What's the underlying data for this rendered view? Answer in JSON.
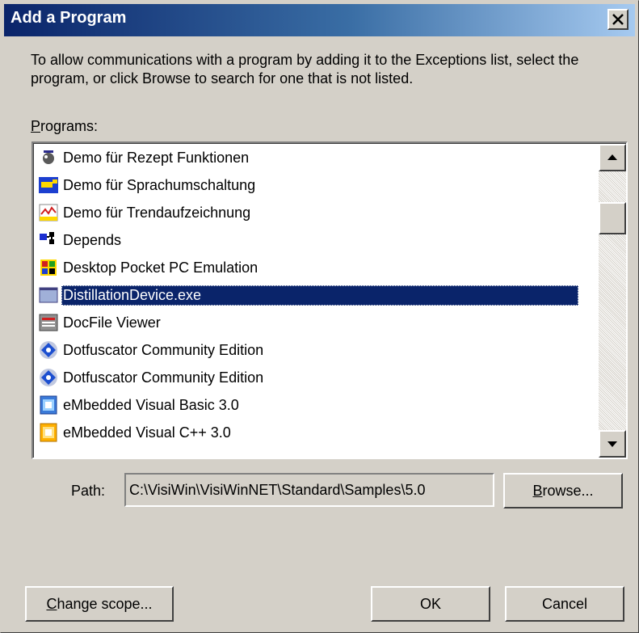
{
  "window": {
    "title": "Add a Program"
  },
  "description": "To allow communications with a program by adding it to the Exceptions list, select the program, or click Browse to search for one that is not listed.",
  "programs_label": {
    "mnemonic": "P",
    "rest": "rograms:"
  },
  "programs": [
    {
      "label": "Demo für Rezept Funktionen",
      "icon": "recipe-icon",
      "selected": false
    },
    {
      "label": "Demo für Sprachumschaltung",
      "icon": "language-flag-icon",
      "selected": false
    },
    {
      "label": "Demo für Trendaufzeichnung",
      "icon": "trend-chart-icon",
      "selected": false
    },
    {
      "label": "Depends",
      "icon": "depends-icon",
      "selected": false
    },
    {
      "label": "Desktop Pocket PC Emulation",
      "icon": "emulator-icon",
      "selected": false
    },
    {
      "label": "DistillationDevice.exe",
      "icon": "app-window-icon",
      "selected": true
    },
    {
      "label": "DocFile Viewer",
      "icon": "docfile-viewer-icon",
      "selected": false
    },
    {
      "label": "Dotfuscator Community Edition",
      "icon": "dotfuscator-icon",
      "selected": false
    },
    {
      "label": "Dotfuscator Community Edition",
      "icon": "dotfuscator-icon",
      "selected": false
    },
    {
      "label": "eMbedded Visual Basic 3.0",
      "icon": "evb-icon",
      "selected": false
    },
    {
      "label": "eMbedded Visual C++ 3.0",
      "icon": "evc-icon",
      "selected": false
    }
  ],
  "path": {
    "label": "Path:",
    "value": "C:\\VisiWin\\VisiWinNET\\Standard\\Samples\\5.0"
  },
  "buttons": {
    "browse": {
      "mnemonic": "B",
      "rest": "rowse..."
    },
    "change_scope": {
      "mnemonic": "C",
      "rest": "hange scope..."
    },
    "ok": "OK",
    "cancel": "Cancel"
  }
}
